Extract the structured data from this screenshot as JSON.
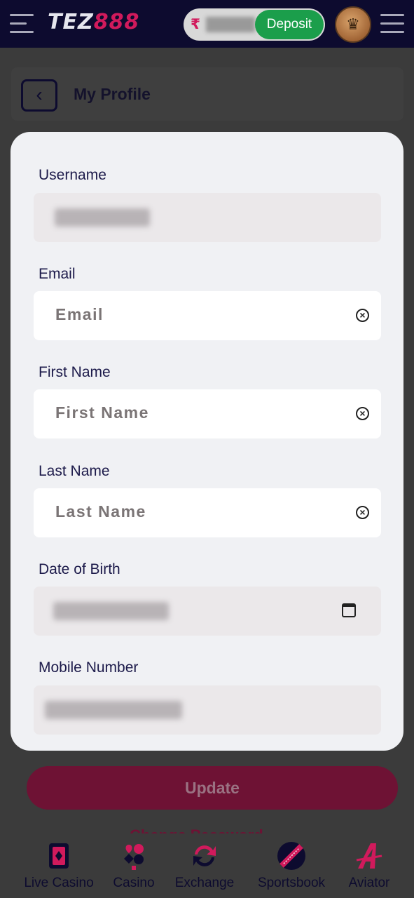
{
  "header": {
    "logo_white": "TEZ",
    "logo_pink": "888",
    "currency_symbol": "₹",
    "deposit_label": "Deposit"
  },
  "page": {
    "title": "My Profile"
  },
  "form": {
    "username_label": "Username",
    "email_label": "Email",
    "email_placeholder": "Email",
    "first_name_label": "First Name",
    "first_name_placeholder": "First Name",
    "last_name_label": "Last Name",
    "last_name_placeholder": "Last Name",
    "dob_label": "Date of Birth",
    "mobile_label": "Mobile Number"
  },
  "actions": {
    "update_label": "Update",
    "change_password_label": "Change Password"
  },
  "bottom_nav": [
    {
      "label": "Live Casino",
      "icon": "live-casino-icon"
    },
    {
      "label": "Casino",
      "icon": "casino-icon"
    },
    {
      "label": "Exchange",
      "icon": "exchange-icon"
    },
    {
      "label": "Sportsbook",
      "icon": "sportsbook-icon"
    },
    {
      "label": "Aviator",
      "icon": "aviator-icon"
    }
  ],
  "colors": {
    "header_bg": "#0d0b2f",
    "brand_pink": "#d11a5c",
    "deposit_green": "#1b9e4b",
    "modal_bg": "#f0f1f4",
    "update_button": "#6e1234"
  }
}
